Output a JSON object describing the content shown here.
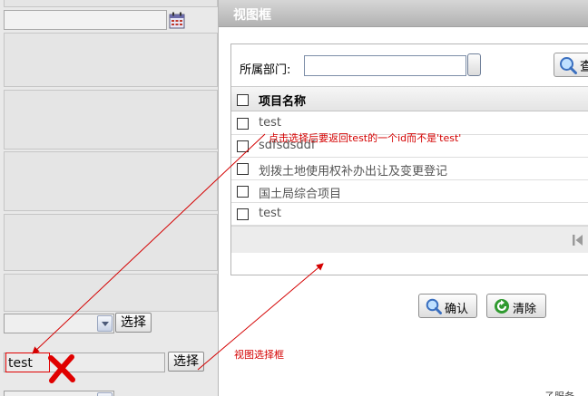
{
  "left_form": {
    "select_button_1": "选择",
    "test_input_value": "test",
    "select_button_2": "选择"
  },
  "dialog": {
    "title": "视图框",
    "filter_label": "所属部门:",
    "filter_value": "",
    "query_button": "查",
    "column_header": "项目名称",
    "rows": [
      "test",
      "sdfsdsddf",
      "划拨土地使用权补办出让及变更登记",
      "国土局综合项目",
      "test"
    ],
    "confirm_button": "确认",
    "clear_button": "清除",
    "bottom_partial_text": "子服务"
  },
  "annotations": {
    "top_note": "点击选择后要返回test的一个id而不是'test'",
    "bottom_note": "视图选择框"
  },
  "colors": {
    "annotation_red": "#d40000",
    "header_gray": "#b2b2b2",
    "icon_green": "#2f9a2f",
    "icon_blue": "#3a6fbf"
  }
}
